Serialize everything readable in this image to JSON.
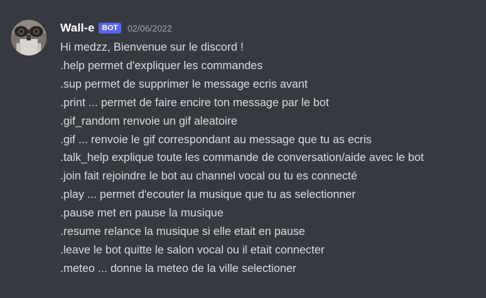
{
  "message": {
    "author": "Wall-e",
    "bot_tag": "BOT",
    "timestamp": "02/06/2022",
    "lines": [
      "Hi medzz, Bienvenue sur le discord !",
      ".help permet d'expliquer les commandes",
      ".sup permet de supprimer le message ecris avant",
      ".print ... permet de faire encire ton message par le bot",
      ".gif_random renvoie un gif aleatoire",
      ".gif ... renvoie le gif correspondant au message que tu as ecris",
      ".talk_help explique toute les commande de conversation/aide avec le bot",
      ".join fait rejoindre le bot au channel vocal ou tu es connecté",
      ".play ... permet d'ecouter la musique que tu as selectionner",
      ".pause met en pause la musique",
      ".resume relance la musique si elle etait en pause",
      ".leave le bot quitte le salon vocal ou il etait connecter",
      ".meteo ... donne la meteo de la ville selectioner"
    ]
  },
  "colors": {
    "background": "#36393f",
    "username": "#ffffff",
    "bot_tag": "#5865f2",
    "timestamp": "#a3a6aa",
    "text": "#dcddde"
  },
  "icons": {
    "avatar": "robot-avatar-icon"
  }
}
